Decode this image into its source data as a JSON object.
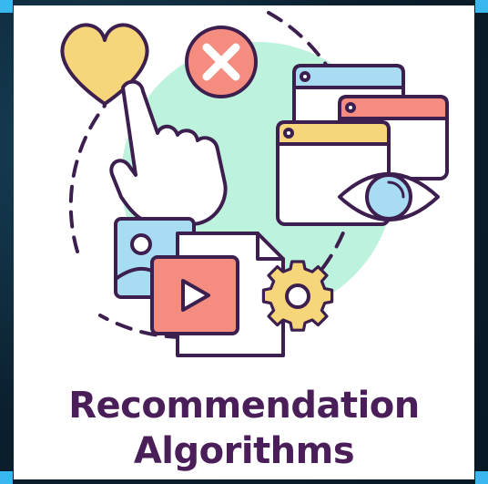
{
  "title": {
    "line1": "Recommendation",
    "line2": "Algorithms"
  },
  "colors": {
    "outline": "#3d1f4f",
    "heart": "#f7d57a",
    "reject": "#f48c80",
    "window_blue": "#a7dcf2",
    "window_red": "#f48c80",
    "window_yellow": "#f7d57a",
    "mint": "#bdf2dc",
    "photo": "#a7dcf2",
    "video": "#f48c80",
    "gear": "#f7d57a"
  },
  "icons": [
    "heart-icon",
    "close-icon",
    "pointing-hand-icon",
    "browser-windows-icon",
    "eye-icon",
    "image-icon",
    "play-icon",
    "document-icon",
    "gear-icon"
  ]
}
